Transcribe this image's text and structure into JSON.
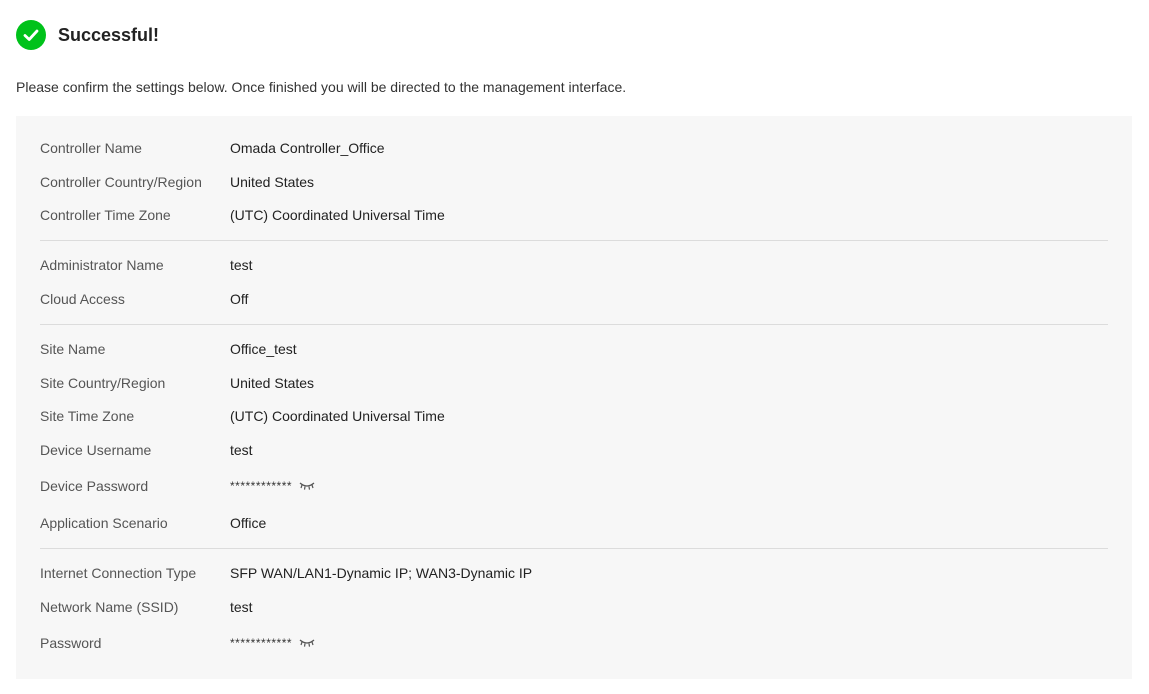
{
  "header": {
    "title": "Successful!",
    "icon": "check-circle-icon",
    "icon_color": "#00c21a"
  },
  "intro_text": "Please confirm the settings below. Once finished you will be directed to the management interface.",
  "controller": {
    "name": {
      "label": "Controller Name",
      "value": "Omada Controller_Office"
    },
    "country": {
      "label": "Controller Country/Region",
      "value": "United States"
    },
    "timezone": {
      "label": "Controller Time Zone",
      "value": "(UTC) Coordinated Universal Time"
    }
  },
  "admin": {
    "name": {
      "label": "Administrator Name",
      "value": "test"
    },
    "cloud": {
      "label": "Cloud Access",
      "value": "Off"
    }
  },
  "site": {
    "name": {
      "label": "Site Name",
      "value": "Office_test"
    },
    "country": {
      "label": "Site Country/Region",
      "value": "United States"
    },
    "timezone": {
      "label": "Site Time Zone",
      "value": "(UTC) Coordinated Universal Time"
    },
    "device_username": {
      "label": "Device Username",
      "value": "test"
    },
    "device_password": {
      "label": "Device Password",
      "value": "************"
    },
    "scenario": {
      "label": "Application Scenario",
      "value": "Office"
    }
  },
  "network": {
    "connection": {
      "label": "Internet Connection Type",
      "value": "SFP WAN/LAN1-Dynamic IP; WAN3-Dynamic IP"
    },
    "ssid": {
      "label": "Network Name (SSID)",
      "value": "test"
    },
    "password": {
      "label": "Password",
      "value": "************"
    }
  },
  "icons": {
    "password_toggle": "eye-closed-icon"
  },
  "colors": {
    "panel_background": "#f7f7f7",
    "success": "#00c21a",
    "divider": "#dcdcdc"
  }
}
